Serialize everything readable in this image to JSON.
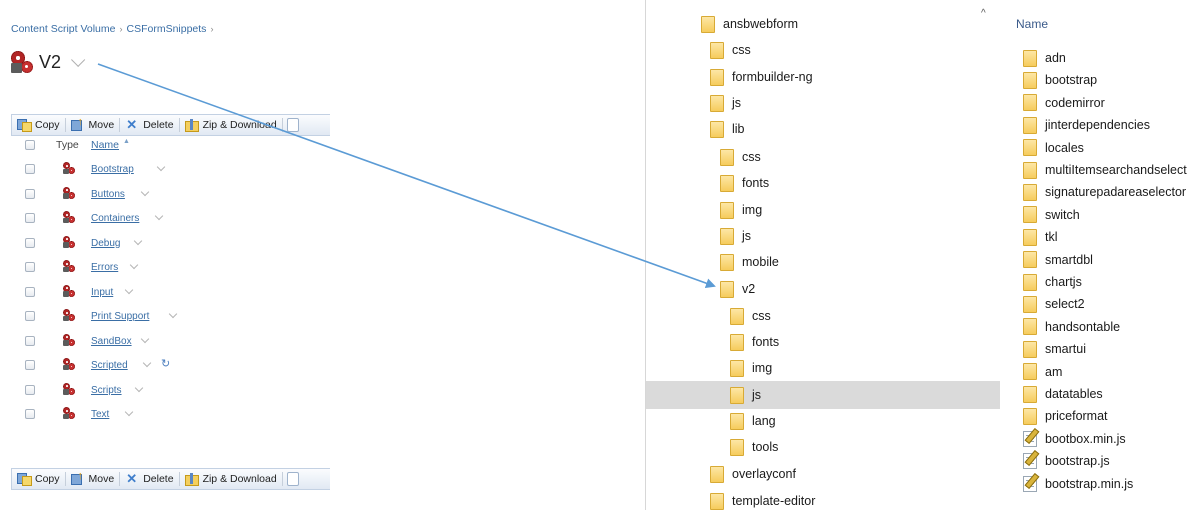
{
  "cs_panel": {
    "breadcrumb": [
      "Content Script Volume",
      "CSFormSnippets"
    ],
    "title": "V2",
    "toolbar": {
      "copy": "Copy",
      "move": "Move",
      "delete": "Delete",
      "zip": "Zip & Download"
    },
    "columns": {
      "type": "Type",
      "name": "Name"
    },
    "rows": [
      {
        "name": "Bootstrap"
      },
      {
        "name": "Buttons"
      },
      {
        "name": "Containers"
      },
      {
        "name": "Debug"
      },
      {
        "name": "Errors"
      },
      {
        "name": "Input"
      },
      {
        "name": "Print Support"
      },
      {
        "name": "SandBox"
      },
      {
        "name": "Scripted"
      },
      {
        "name": "Scripts"
      },
      {
        "name": "Text"
      }
    ],
    "refresh_glyph": "↻"
  },
  "folder_tree": {
    "scroll_up_glyph": "^",
    "items": [
      {
        "label": "ansbwebform",
        "indent": 0
      },
      {
        "label": "css",
        "indent": 1
      },
      {
        "label": "formbuilder-ng",
        "indent": 1
      },
      {
        "label": "js",
        "indent": 1
      },
      {
        "label": "lib",
        "indent": 1
      },
      {
        "label": "css",
        "indent": 2
      },
      {
        "label": "fonts",
        "indent": 2
      },
      {
        "label": "img",
        "indent": 2
      },
      {
        "label": "js",
        "indent": 2
      },
      {
        "label": "mobile",
        "indent": 2
      },
      {
        "label": "v2",
        "indent": 2
      },
      {
        "label": "css",
        "indent": 3
      },
      {
        "label": "fonts",
        "indent": 3
      },
      {
        "label": "img",
        "indent": 3
      },
      {
        "label": "js",
        "indent": 3,
        "selected": true
      },
      {
        "label": "lang",
        "indent": 3
      },
      {
        "label": "tools",
        "indent": 3
      },
      {
        "label": "overlayconf",
        "indent": 1
      },
      {
        "label": "template-editor",
        "indent": 1
      }
    ]
  },
  "file_list": {
    "header": "Name",
    "items": [
      {
        "label": "adn",
        "kind": "folder"
      },
      {
        "label": "bootstrap",
        "kind": "folder"
      },
      {
        "label": "codemirror",
        "kind": "folder"
      },
      {
        "label": "jinterdependencies",
        "kind": "folder"
      },
      {
        "label": "locales",
        "kind": "folder"
      },
      {
        "label": "multiItemsearchandselect",
        "kind": "folder"
      },
      {
        "label": "signaturepadareaselector",
        "kind": "folder"
      },
      {
        "label": "switch",
        "kind": "folder"
      },
      {
        "label": "tkl",
        "kind": "folder"
      },
      {
        "label": "smartdbl",
        "kind": "folder"
      },
      {
        "label": "chartjs",
        "kind": "folder"
      },
      {
        "label": "select2",
        "kind": "folder"
      },
      {
        "label": "handsontable",
        "kind": "folder"
      },
      {
        "label": "smartui",
        "kind": "folder"
      },
      {
        "label": "am",
        "kind": "folder"
      },
      {
        "label": "datatables",
        "kind": "folder"
      },
      {
        "label": "priceformat",
        "kind": "folder"
      },
      {
        "label": "bootbox.min.js",
        "kind": "jsfile"
      },
      {
        "label": "bootstrap.js",
        "kind": "jsfile"
      },
      {
        "label": "bootstrap.min.js",
        "kind": "jsfile"
      }
    ]
  },
  "colors": {
    "link": "#3a6ea5",
    "arrow": "#5b9bd5",
    "selection": "#dadada",
    "folder": "#f6cc5d"
  }
}
